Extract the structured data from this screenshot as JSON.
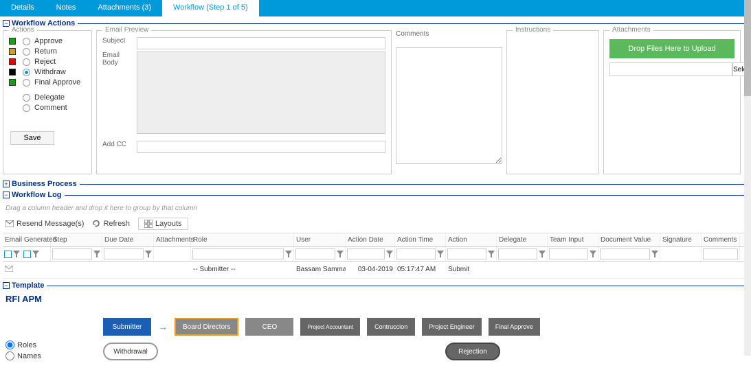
{
  "tabs": {
    "details": "Details",
    "notes": "Notes",
    "attachments": "Attachments (3)",
    "workflow": "Workflow (Step 1 of 5)"
  },
  "sections": {
    "workflow_actions": "Workflow Actions",
    "business_process": "Business Process",
    "workflow_log": "Workflow Log",
    "template": "Template"
  },
  "actions_panel": {
    "legend": "Actions",
    "approve": "Approve",
    "return": "Return",
    "reject": "Reject",
    "withdraw": "Withdraw",
    "final_approve": "Final Approve",
    "delegate": "Delegate",
    "comment": "Comment",
    "save": "Save",
    "colors": {
      "approve": "#18a018",
      "return": "#d0a020",
      "reject": "#e00000",
      "withdraw": "#000000",
      "final_approve": "#18a018"
    }
  },
  "email_panel": {
    "legend": "Email Preview",
    "subject": "Subject",
    "body": "Email Body",
    "addcc": "Add CC"
  },
  "comments_panel": {
    "legend": "Comments"
  },
  "instructions_panel": {
    "legend": "Instructions"
  },
  "attachments_panel": {
    "legend": "Attachments",
    "upload": "Drop Files Here to Upload",
    "select": "Select"
  },
  "log": {
    "grouping_hint": "Drag a column header and drop it here to group by that column",
    "resend": "Resend Message(s)",
    "refresh": "Refresh",
    "layouts": "Layouts",
    "headers": {
      "email": "Email",
      "generated": "Generated",
      "step": "Step",
      "due_date": "Due Date",
      "attachments": "Attachments",
      "role": "Role",
      "user": "User",
      "action_date": "Action Date",
      "action_time": "Action Time",
      "action": "Action",
      "delegate": "Delegate",
      "team_input": "Team Input",
      "doc_value": "Document Value",
      "signature": "Signature",
      "comments": "Comments"
    },
    "rows": [
      {
        "role": "-- Submitter --",
        "user": "Bassam Samman(Ba",
        "action_date": "03-04-2019",
        "action_time": "05:17:47 AM",
        "action": "Submit"
      }
    ]
  },
  "template": {
    "title": "RFI APM",
    "radio_roles": "Roles",
    "radio_names": "Names",
    "nodes": {
      "submitter": "Submitter",
      "board": "Board Directors",
      "ceo": "CEO",
      "pa": "Project Accountant",
      "construction": "Contruccion",
      "pe": "Project Engineer",
      "final": "Final Approve",
      "withdrawal": "Withdrawal",
      "rejection": "Rejection"
    }
  },
  "chart_data": null
}
